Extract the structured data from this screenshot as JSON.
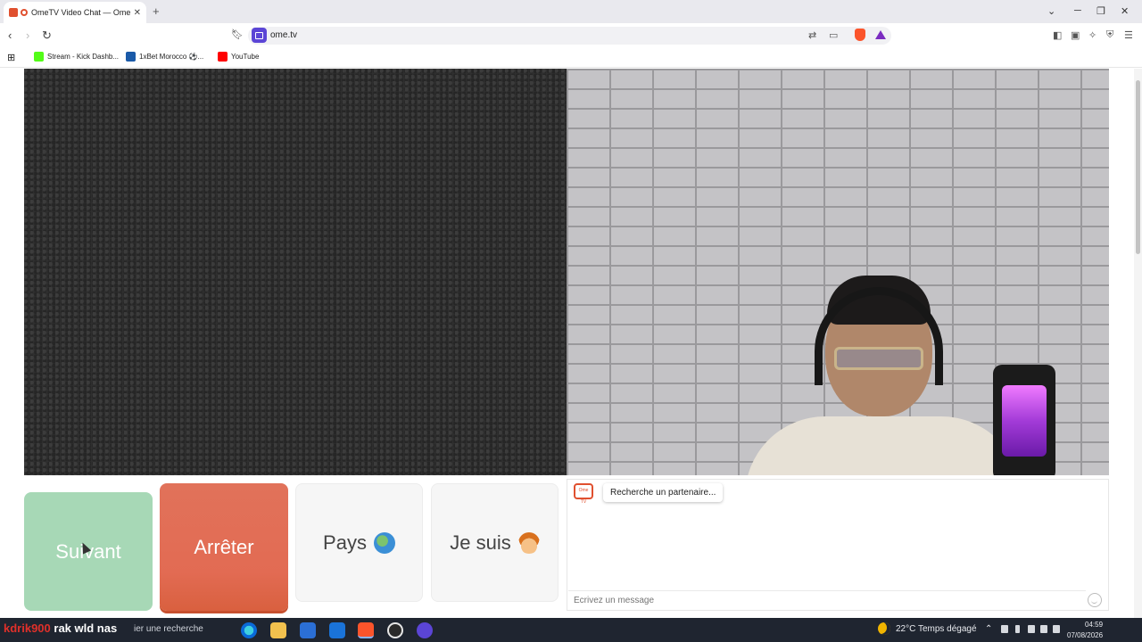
{
  "browser": {
    "tab_title": "OmeTV Video Chat — Omeg",
    "tab_close": "✕",
    "new_tab": "+",
    "url": "ome.tv",
    "bookmarks": [
      {
        "label": "Stream - Kick Dashb...",
        "icon": "kick-icon",
        "color": "#53fc18"
      },
      {
        "label": "1xBet Morocco ⚽...",
        "icon": "1xbet-icon",
        "color": "#1a5aa8"
      },
      {
        "label": "YouTube",
        "icon": "youtube-icon",
        "color": "#ff0000"
      }
    ]
  },
  "page": {
    "buttons": {
      "next": "Suivant",
      "stop": "Arrêter",
      "country": "Pays",
      "iam": "Je suis"
    },
    "chat": {
      "status": "Recherche un partenaire...",
      "logo": "Ome TV",
      "input_placeholder": "Écrivez un message"
    }
  },
  "overlay": {
    "stream_user_red": "kdrik900",
    "stream_text": "rak wld nas"
  },
  "taskbar": {
    "search_text": "ier une recherche",
    "weather": "22°C  Temps dégagé",
    "time": "04:59",
    "date": "07/08/2026",
    "apps": [
      "edge-icon",
      "file-explorer-icon",
      "store-icon",
      "mail-icon",
      "brave-icon",
      "obs-icon",
      "app-icon"
    ]
  },
  "colors": {
    "next": "#a7d8b6",
    "stop": "#e26b53",
    "brand": "#5b45d6",
    "taskbar": "#1f2530"
  }
}
